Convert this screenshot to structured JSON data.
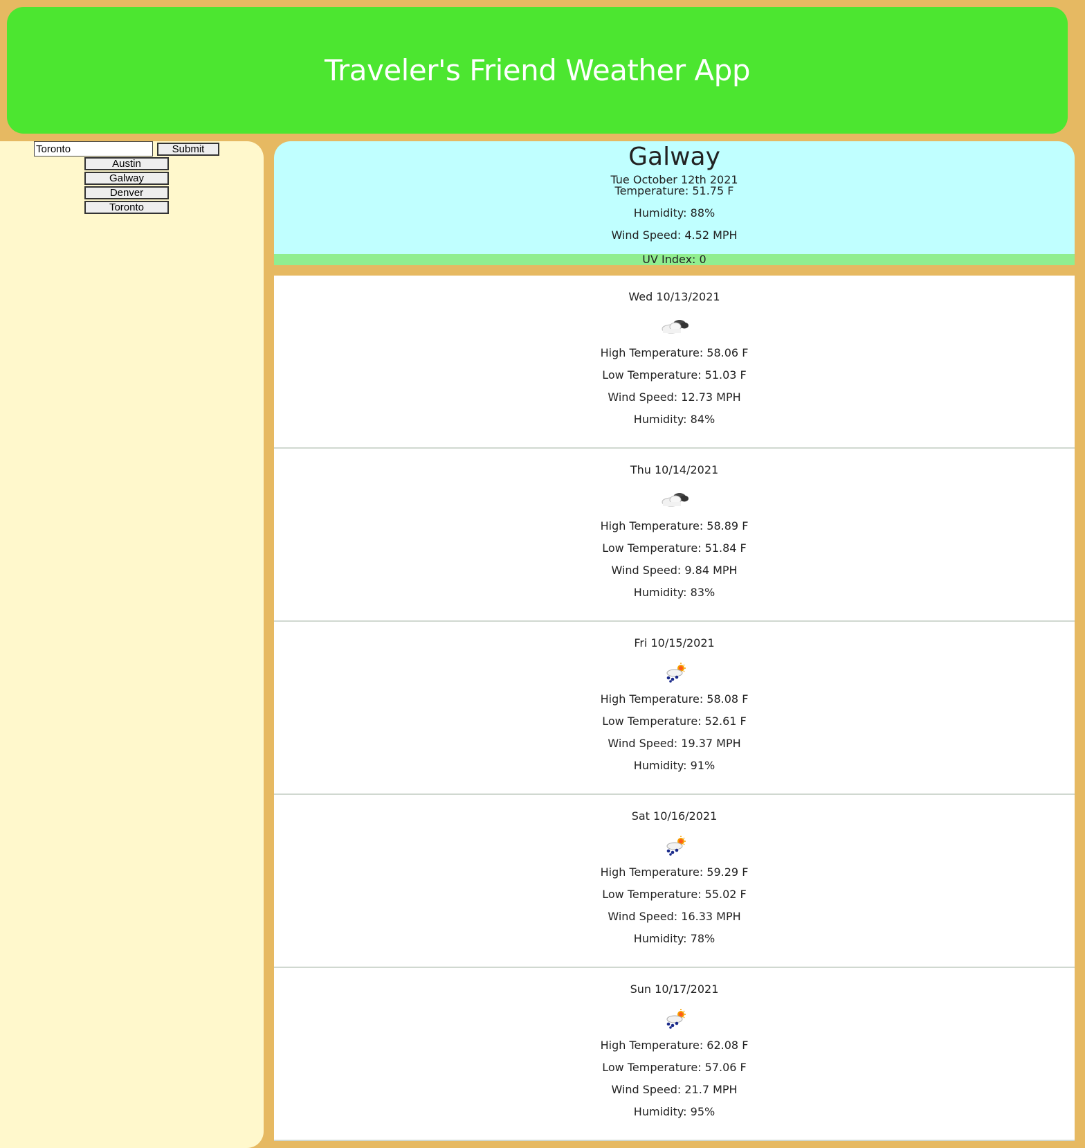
{
  "header": {
    "title": "Traveler's Friend Weather App"
  },
  "sidebar": {
    "search_value": "Toronto",
    "submit_label": "Submit",
    "history": [
      {
        "label": "Austin"
      },
      {
        "label": "Galway"
      },
      {
        "label": "Denver"
      },
      {
        "label": "Toronto"
      }
    ]
  },
  "current": {
    "city": "Galway",
    "date": "Tue October 12th 2021",
    "temperature": "Temperature: 51.75 F",
    "humidity": "Humidity: 88%",
    "wind": "Wind Speed: 4.52 MPH",
    "uv": "UV Index: 0"
  },
  "forecast": [
    {
      "date": "Wed 10/13/2021",
      "icon": "cloudy-icon",
      "high": "High Temperature: 58.06 F",
      "low": "Low Temperature: 51.03 F",
      "wind": "Wind Speed: 12.73 MPH",
      "humidity": "Humidity: 84%"
    },
    {
      "date": "Thu 10/14/2021",
      "icon": "cloudy-icon",
      "high": "High Temperature: 58.89 F",
      "low": "Low Temperature: 51.84 F",
      "wind": "Wind Speed: 9.84 MPH",
      "humidity": "Humidity: 83%"
    },
    {
      "date": "Fri 10/15/2021",
      "icon": "rain-sun-icon",
      "high": "High Temperature: 58.08 F",
      "low": "Low Temperature: 52.61 F",
      "wind": "Wind Speed: 19.37 MPH",
      "humidity": "Humidity: 91%"
    },
    {
      "date": "Sat 10/16/2021",
      "icon": "rain-sun-icon",
      "high": "High Temperature: 59.29 F",
      "low": "Low Temperature: 55.02 F",
      "wind": "Wind Speed: 16.33 MPH",
      "humidity": "Humidity: 78%"
    },
    {
      "date": "Sun 10/17/2021",
      "icon": "rain-sun-icon",
      "high": "High Temperature: 62.08 F",
      "low": "Low Temperature: 57.06 F",
      "wind": "Wind Speed: 21.7 MPH",
      "humidity": "Humidity: 95%"
    }
  ],
  "colors": {
    "background": "#e6b962",
    "header": "#4ce630",
    "sidebar": "#fff8cc",
    "current": "#c0ffff",
    "uv_bar": "#90ee90"
  }
}
